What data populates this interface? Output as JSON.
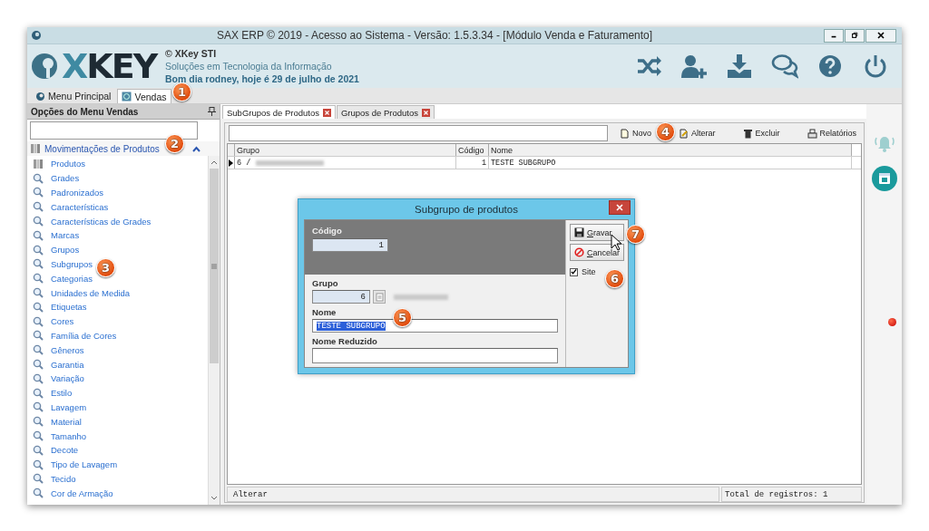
{
  "window": {
    "title": "SAX ERP © 2019 - Acesso ao Sistema - Versão: 1.5.3.34 - [Módulo Venda e Faturamento]"
  },
  "header": {
    "logo": "XKEY",
    "company": "© XKey STI",
    "tagline": "Soluções em Tecnologia da Informação",
    "greeting": "Bom dia rodney, hoje é 29 de julho de 2021"
  },
  "module_tabs": [
    {
      "label": "Menu Principal",
      "selected": false
    },
    {
      "label": "Vendas",
      "selected": true
    }
  ],
  "sidebar": {
    "title": "Opções do Menu Vendas",
    "group": {
      "label": "Movimentações de Produtos",
      "expanded": true
    },
    "items": [
      {
        "label": "Produtos",
        "kind": "folder"
      },
      {
        "label": "Grades",
        "kind": "search"
      },
      {
        "label": "Padronizados",
        "kind": "search"
      },
      {
        "label": "Características",
        "kind": "search"
      },
      {
        "label": "Características de Grades",
        "kind": "search"
      },
      {
        "label": "Marcas",
        "kind": "search"
      },
      {
        "label": "Grupos",
        "kind": "search"
      },
      {
        "label": "Subgrupos",
        "kind": "search"
      },
      {
        "label": "Categorias",
        "kind": "search"
      },
      {
        "label": "Unidades de Medida",
        "kind": "search"
      },
      {
        "label": "Etiquetas",
        "kind": "search"
      },
      {
        "label": "Cores",
        "kind": "search"
      },
      {
        "label": "Família de Cores",
        "kind": "search"
      },
      {
        "label": "Gêneros",
        "kind": "search"
      },
      {
        "label": "Garantia",
        "kind": "search"
      },
      {
        "label": "Variação",
        "kind": "search"
      },
      {
        "label": "Estilo",
        "kind": "search"
      },
      {
        "label": "Lavagem",
        "kind": "search"
      },
      {
        "label": "Material",
        "kind": "search"
      },
      {
        "label": "Tamanho",
        "kind": "search"
      },
      {
        "label": "Decote",
        "kind": "search"
      },
      {
        "label": "Tipo de Lavagem",
        "kind": "search"
      },
      {
        "label": "Tecido",
        "kind": "search"
      },
      {
        "label": "Cor de Armação",
        "kind": "search"
      }
    ]
  },
  "doc_tabs": [
    {
      "label": "SubGrupos de Produtos",
      "selected": true
    },
    {
      "label": "Grupos de Produtos",
      "selected": false
    }
  ],
  "toolbar": [
    {
      "label": "Novo",
      "kind": "new"
    },
    {
      "label": "Alterar",
      "kind": "edit"
    },
    {
      "label": "Excluir",
      "kind": "delete"
    },
    {
      "label": "Relatórios",
      "kind": "print"
    }
  ],
  "table": {
    "columns": [
      "Grupo",
      "Código",
      "Nome"
    ],
    "rows": [
      {
        "cells": [
          "6 /",
          "1",
          "TESTE SUBGRUPO"
        ],
        "selected": true
      }
    ]
  },
  "status_bar": {
    "message": "Alterar",
    "total": "Total de registros: 1"
  },
  "dialog": {
    "title": "Subgrupo de produtos",
    "code": {
      "label": "Código",
      "value": "1"
    },
    "group": {
      "label": "Grupo",
      "value": "6"
    },
    "name": {
      "label": "Nome",
      "value": "TESTE SUBGRUPO",
      "highlighted": true
    },
    "short_name": {
      "label": "Nome Reduzido"
    },
    "buttons": [
      {
        "label": "Gravar",
        "kind": "save"
      },
      {
        "label": "Cancelar",
        "kind": "cancel"
      }
    ],
    "site": {
      "label": "Site",
      "checked": true
    }
  },
  "annotations": [
    "1",
    "2",
    "3",
    "4",
    "5",
    "6",
    "7"
  ]
}
